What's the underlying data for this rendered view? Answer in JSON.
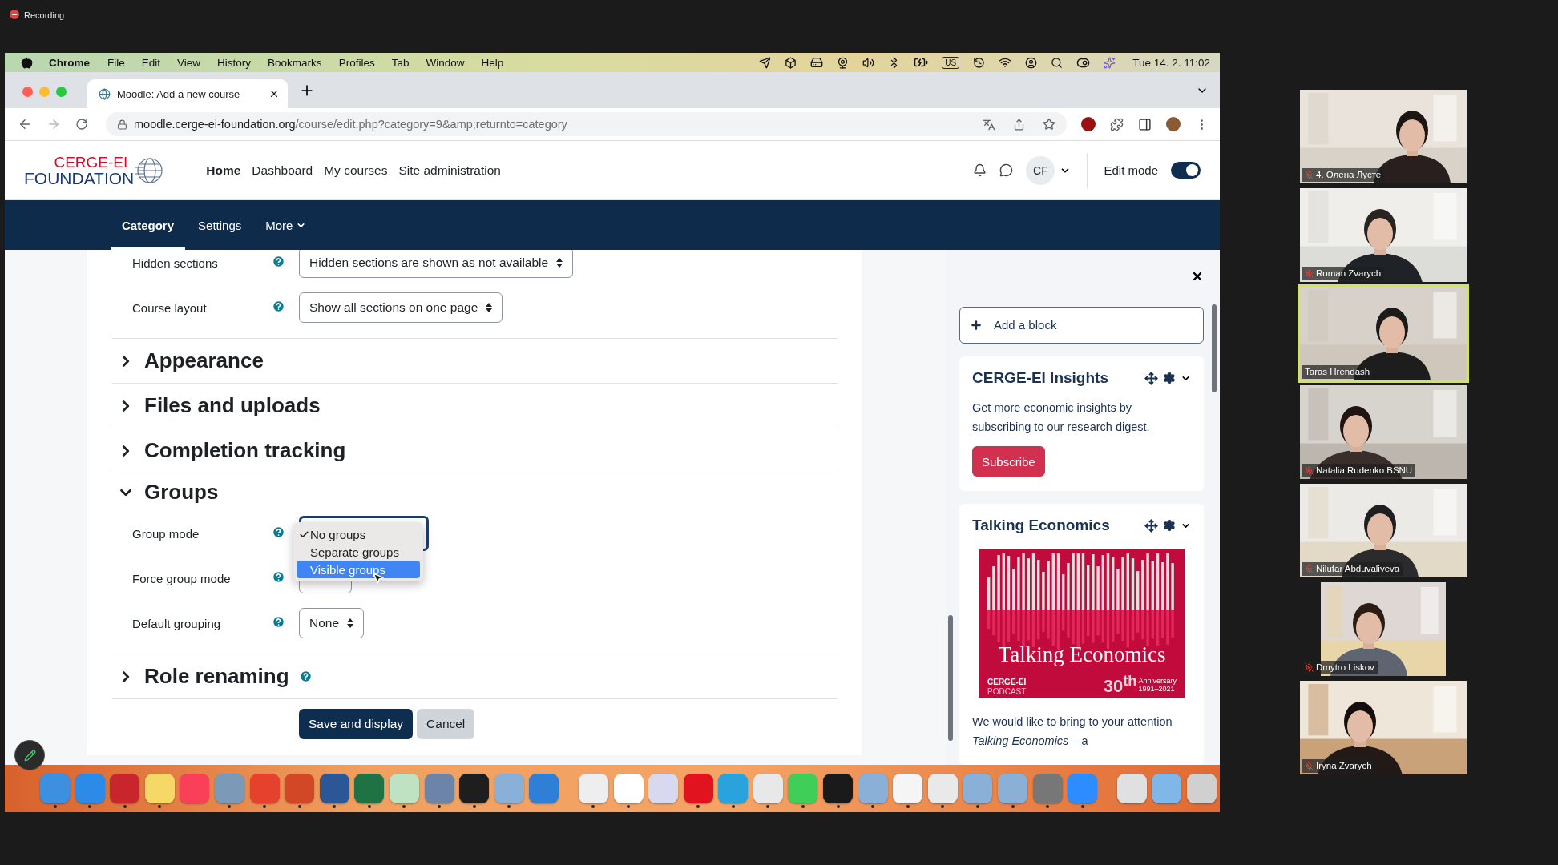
{
  "recording": {
    "label": "Recording"
  },
  "menubar": {
    "app": "Chrome",
    "menus": [
      "File",
      "Edit",
      "View",
      "History",
      "Bookmarks",
      "Profiles",
      "Tab",
      "Window",
      "Help"
    ],
    "input_source": "US",
    "clock": "Tue 14. 2.  11:02"
  },
  "browser": {
    "tab_title": "Moodle: Add a new course",
    "url_host": "moodle.cerge-ei-foundation.org",
    "url_path": "/course/edit.php?category=9&amp;returnto=category"
  },
  "site": {
    "logo_top": "CERGE-EI",
    "logo_bottom": "FOUNDATION",
    "nav": [
      {
        "label": "Home",
        "selected": true
      },
      {
        "label": "Dashboard",
        "selected": false
      },
      {
        "label": "My courses",
        "selected": false
      },
      {
        "label": "Site administration",
        "selected": false
      }
    ],
    "user_initials": "CF",
    "edit_mode": {
      "label": "Edit mode",
      "on": true
    }
  },
  "secondary_nav": [
    {
      "label": "Category",
      "selected": true
    },
    {
      "label": "Settings",
      "selected": false
    },
    {
      "label": "More",
      "selected": false
    }
  ],
  "form": {
    "items": [
      {
        "kind": "field",
        "label": "Hidden sections",
        "help": true,
        "value": "Hidden sections are shown as not available"
      },
      {
        "kind": "field",
        "label": "Course layout",
        "help": true,
        "value": "Show all sections on one page"
      },
      {
        "kind": "section",
        "title": "Appearance",
        "expanded": false,
        "help": false
      },
      {
        "kind": "section",
        "title": "Files and uploads",
        "expanded": false,
        "help": false
      },
      {
        "kind": "section",
        "title": "Completion tracking",
        "expanded": false,
        "help": false
      },
      {
        "kind": "section",
        "title": "Groups",
        "expanded": true,
        "help": false
      },
      {
        "kind": "field",
        "label": "Group mode",
        "help": true,
        "menu": [
          {
            "label": "No groups",
            "checked": true,
            "selected": false
          },
          {
            "label": "Separate groups",
            "checked": false,
            "selected": false
          },
          {
            "label": "Visible groups",
            "checked": false,
            "selected": true
          }
        ]
      },
      {
        "kind": "field",
        "label": "Force group mode",
        "help": true
      },
      {
        "kind": "field",
        "label": "Default grouping",
        "help": true,
        "value": "None"
      },
      {
        "kind": "section",
        "title": "Role renaming",
        "expanded": false,
        "help": true
      }
    ],
    "buttons": [
      {
        "label": "Save and display",
        "kind": "primary"
      },
      {
        "label": "Cancel",
        "kind": "secondary"
      }
    ]
  },
  "drawer": {
    "add_block": "Add a block",
    "insights": {
      "title": "CERGE-EI Insights",
      "text": "Get more economic insights by subscribing to our research digest.",
      "button": "Subscribe"
    },
    "podcast": {
      "title": "Talking Economics",
      "cover_title": "Talking Economics",
      "cover_brand": "CERGE-EI",
      "cover_sub": "PODCAST",
      "cover_number": "30$^{th}$",
      "cover_anniversary": "Anniversary",
      "cover_years": "1991–2021",
      "text": "We would like to bring to your attention *Talking Economics* – a"
    }
  },
  "dock": [
    {
      "running": true
    },
    {
      "running": true
    },
    {
      "running": true
    },
    {
      "running": true
    },
    {
      "running": false
    },
    {
      "running": true
    },
    {
      "running": true
    },
    {
      "running": true
    },
    {
      "running": true
    },
    {
      "running": true
    },
    {
      "running": true
    },
    {
      "running": true
    },
    {
      "running": true
    },
    {
      "running": true
    },
    {
      "running": false
    },
    {
      "running": true
    },
    {
      "running": true
    },
    {
      "running": false
    },
    {
      "running": true
    },
    {
      "running": true
    },
    {
      "running": true
    },
    {
      "running": true
    },
    {
      "running": true
    },
    {
      "running": true
    },
    {
      "running": true
    },
    {
      "running": true
    },
    {
      "running": true
    },
    {
      "running": true
    },
    {
      "running": true
    },
    {
      "running": true
    },
    {
      "running": false
    },
    {
      "running": false
    },
    {
      "running": false
    }
  ],
  "participants": [
    {
      "name": "4. Олена Лусте",
      "muted": true,
      "speaking": false
    },
    {
      "name": "Roman Zvarych",
      "muted": true,
      "speaking": false
    },
    {
      "name": "Taras Hrendash",
      "muted": false,
      "speaking": true
    },
    {
      "name": "Natalia Rudenko BSNU",
      "muted": true,
      "speaking": false
    },
    {
      "name": "Nilufar Abduvaliyeva",
      "muted": true,
      "speaking": false
    },
    {
      "name": "Dmytro Liskov",
      "muted": true,
      "speaking": false
    },
    {
      "name": "Iryna Zvarych",
      "muted": true,
      "speaking": false
    }
  ]
}
